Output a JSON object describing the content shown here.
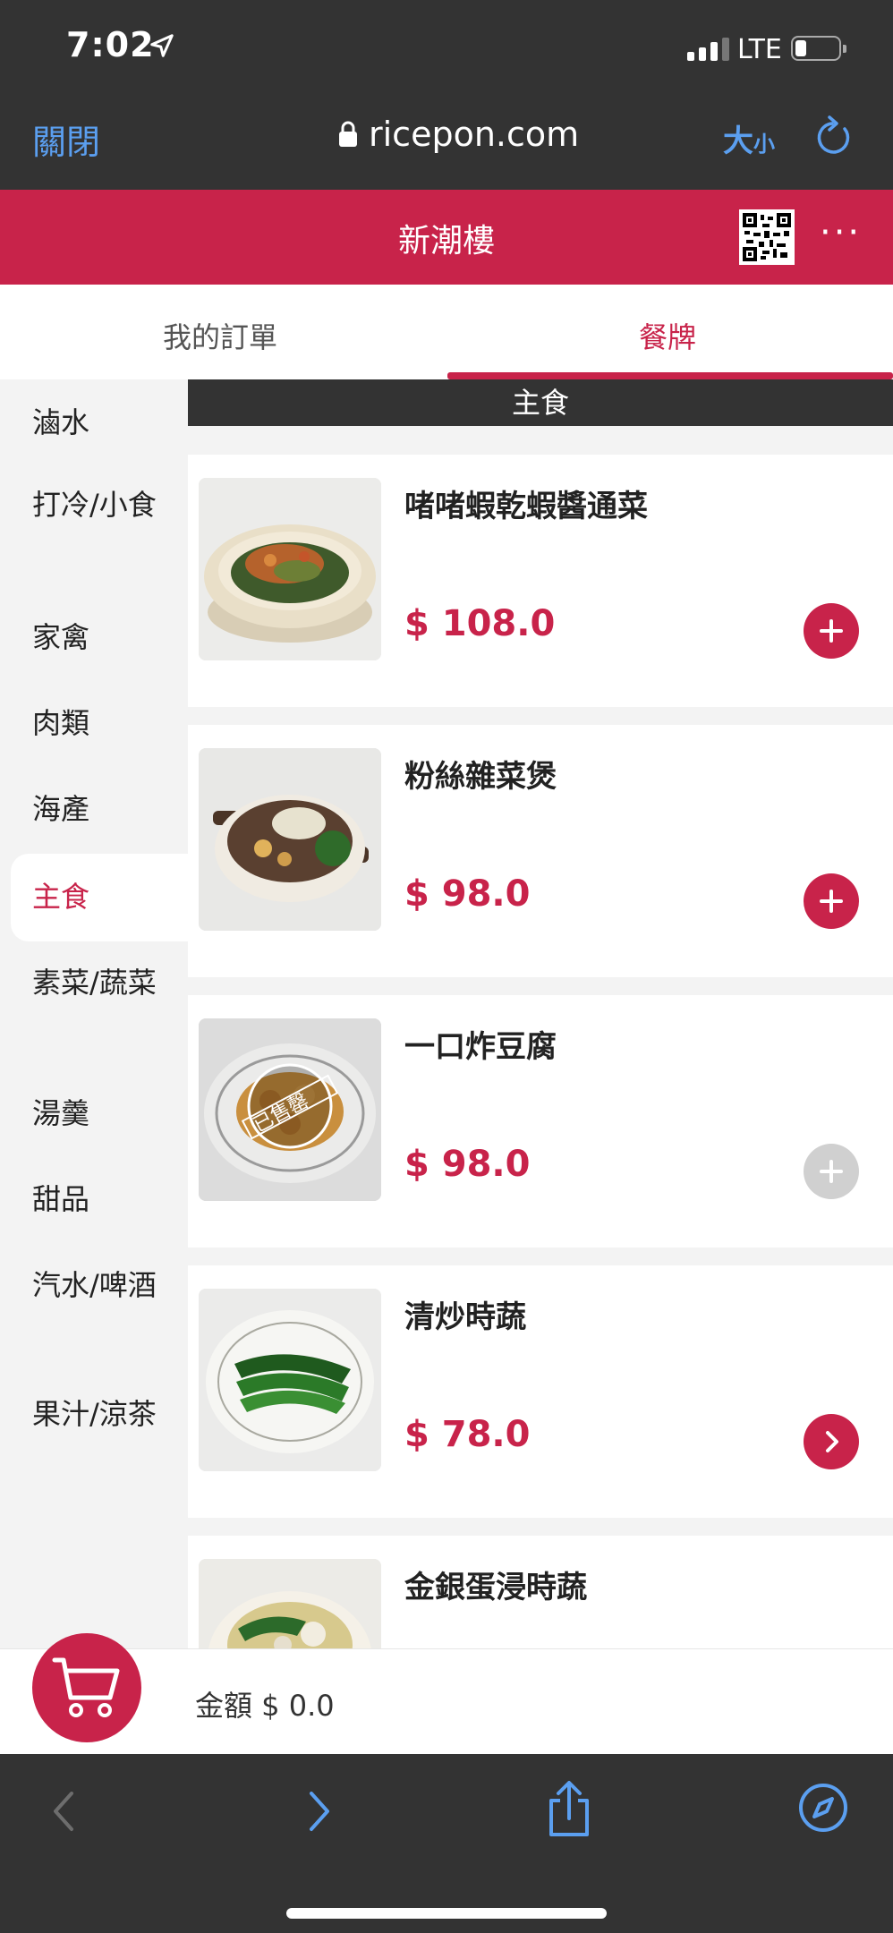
{
  "status": {
    "time": "7:02",
    "network": "LTE"
  },
  "browser": {
    "close": "關閉",
    "url": "ricepon.com",
    "size_big": "大",
    "size_small": "小"
  },
  "header": {
    "shop_name": "新潮樓"
  },
  "tabs": {
    "orders": "我的訂單",
    "menu": "餐牌",
    "active": "menu"
  },
  "sidebar": {
    "categories": [
      {
        "label": "滷水"
      },
      {
        "label": "打冷/小食"
      },
      {
        "label": "家禽"
      },
      {
        "label": "肉類"
      },
      {
        "label": "海產"
      },
      {
        "label": "主食",
        "active": true
      },
      {
        "label": "素菜/蔬菜"
      },
      {
        "label": "湯羹"
      },
      {
        "label": "甜品"
      },
      {
        "label": "汽水/啤酒"
      },
      {
        "label": "果汁/涼茶"
      }
    ]
  },
  "menu": {
    "section_title": "主食",
    "items": [
      {
        "name": "啫啫蝦乾蝦醬通菜",
        "price": "$ 108.0",
        "action": "add"
      },
      {
        "name": "粉絲雜菜煲",
        "price": "$ 98.0",
        "action": "add"
      },
      {
        "name": "一口炸豆腐",
        "price": "$ 98.0",
        "action": "add-disabled",
        "sold_out_stamp": "已售罄"
      },
      {
        "name": "清炒時蔬",
        "price": "$ 78.0",
        "action": "options"
      },
      {
        "name": "金銀蛋浸時蔬",
        "price": "",
        "action": ""
      }
    ]
  },
  "cart": {
    "total_label": "金額 $ 0.0"
  },
  "colors": {
    "accent": "#c8234a",
    "dark": "#333333",
    "link": "#5b9ff0",
    "disabled": "#d0d0d0"
  },
  "icons": [
    "location-arrow-icon",
    "signal-icon",
    "battery-icon",
    "lock-icon",
    "reload-icon",
    "qr-code-icon",
    "more-icon",
    "plus-icon",
    "chevron-right-icon",
    "cart-icon",
    "back-icon",
    "forward-icon",
    "share-icon",
    "compass-icon"
  ]
}
